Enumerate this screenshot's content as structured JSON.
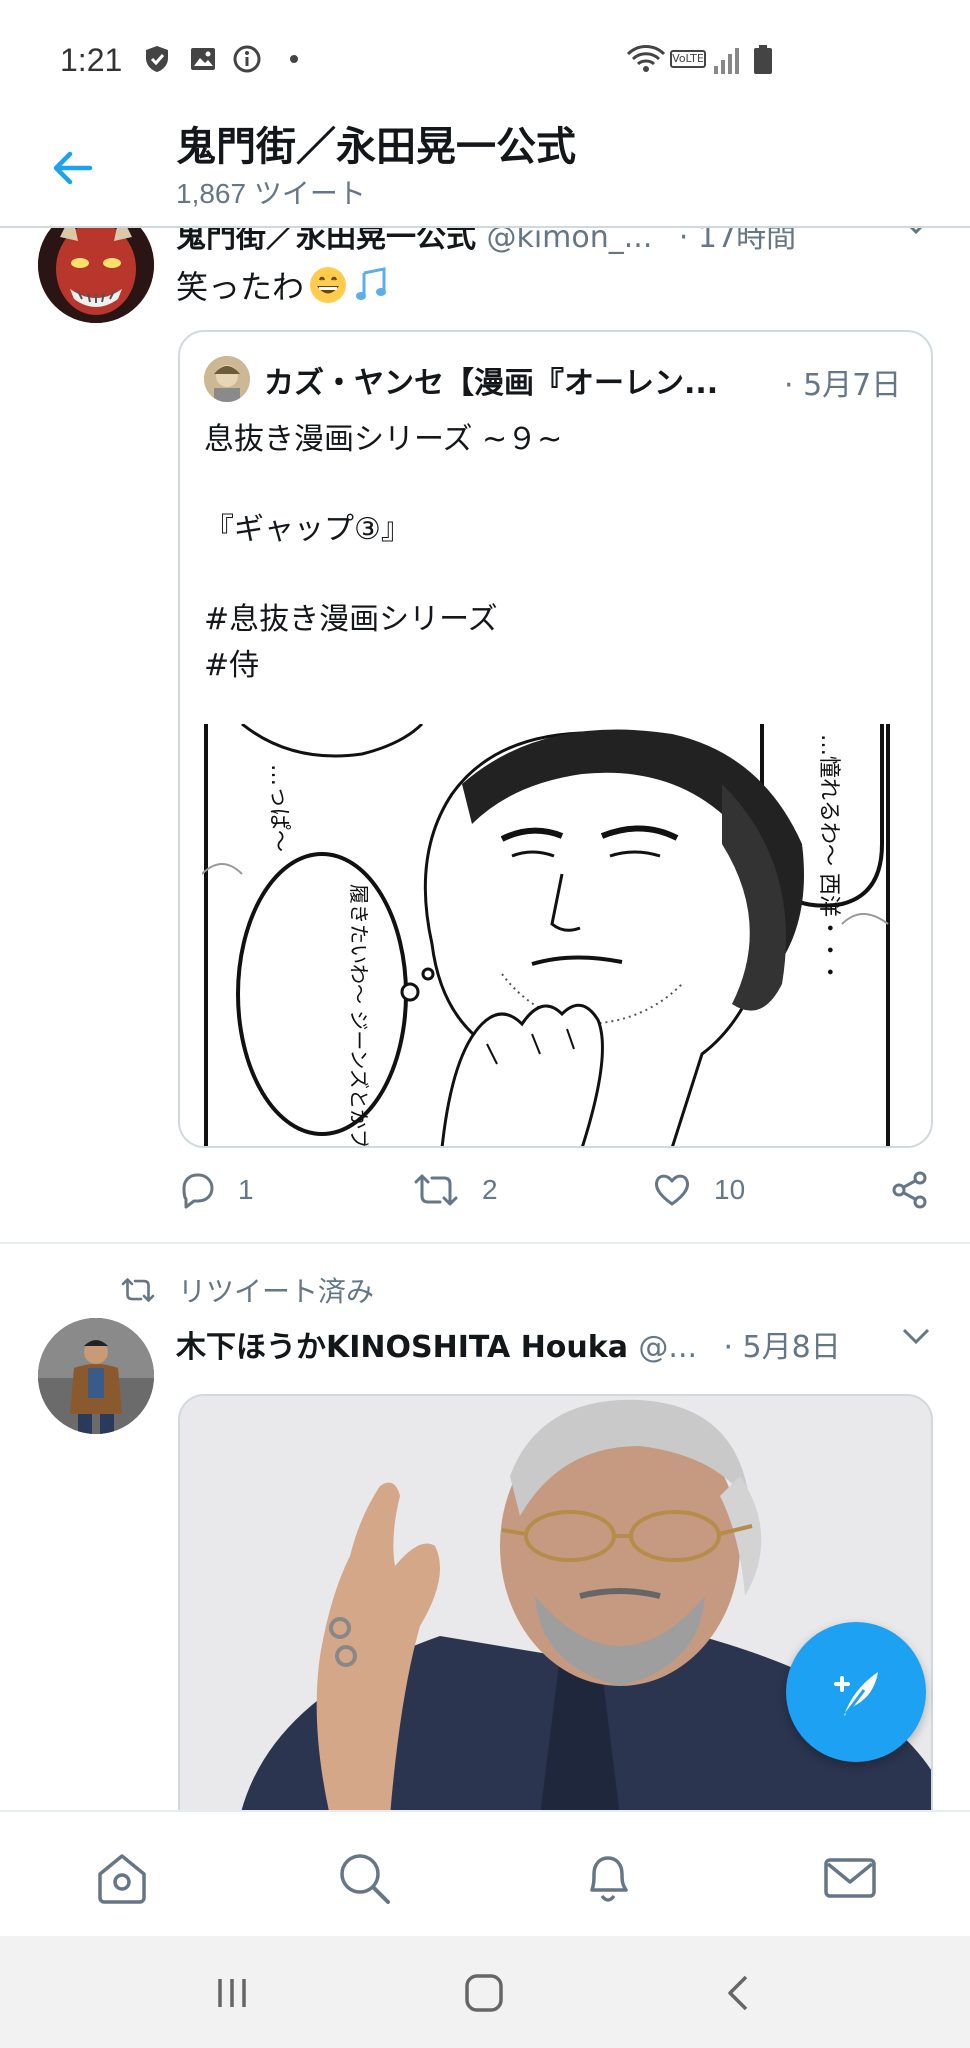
{
  "status_bar": {
    "time": "1:21",
    "icons_left": [
      "shield-icon",
      "image-icon",
      "info-icon",
      "dot-icon"
    ],
    "network_label": "VoLTE",
    "icons_right": [
      "wifi-icon",
      "volte-icon",
      "signal-icon",
      "battery-icon"
    ]
  },
  "header": {
    "title": "鬼門街／永田晃一公式",
    "subtitle": "1,867 ツイート"
  },
  "tweet1": {
    "author_line": "鬼門街／永田晃一公式",
    "handle": "@kimon_...",
    "time": "· 17時間",
    "text": "笑ったわ",
    "emojis": [
      "grinning-face-emoji",
      "musical-notes-emoji"
    ],
    "quote": {
      "author": "カズ・ヤンセ【漫画『オーレン...",
      "date": "· 5月7日",
      "lines": [
        "息抜き漫画シリーズ ~９~",
        "",
        "『ギャップ③』",
        "",
        "#息抜き漫画シリーズ",
        "#侍"
      ],
      "image_bubbles": {
        "top_left": "…っぱ〜",
        "right": "…憧れるわ〜 西洋・・・",
        "left": "履きたいわ〜 ジーンズとかブーツ ってやつ…"
      }
    },
    "actions": {
      "reply_count": "1",
      "retweet_count": "2",
      "like_count": "10"
    }
  },
  "tweet2": {
    "retweet_label": "リツイート済み",
    "author": "木下ほうかKINOSHITA Houka",
    "handle": "@...",
    "date": "· 5月8日"
  },
  "colors": {
    "accent": "#1da1f2",
    "text": "#14171a",
    "muted": "#657786",
    "border": "#cfd9de"
  },
  "bottom_nav": [
    "home-icon",
    "search-icon",
    "notifications-icon",
    "messages-icon"
  ],
  "system_nav": [
    "recents-icon",
    "home-button-icon",
    "back-icon"
  ]
}
